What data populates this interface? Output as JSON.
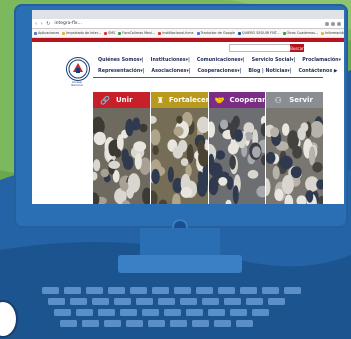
{
  "browser": {
    "nav_glyphs": "‹ › ↻",
    "url": "integra-flx...",
    "bookmarks": [
      "Aplicaciones",
      "Importado de Inter...",
      "SMS",
      "ForoColimas Mexi...",
      "InstiNacional.fcmx",
      "Traductor de Google",
      "QUIERO SEGUIR FNT...",
      "Otros Cuadernos...",
      "Información de dispo..."
    ]
  },
  "site": {
    "search_button": "Buscar",
    "logo_caption": "Consejo Nacional",
    "menu_row1": [
      "Quiénes Somos▾|",
      "Instituciones▾|",
      "Comunicaciones▾|",
      "Servicio Social▾|",
      "Proclamación▾"
    ],
    "menu_row2": [
      "Representación▾|",
      "Asociaciones▾|",
      "Cooperaciones▾|",
      "Blog | Noticias▾|",
      "Contáctenos ▶"
    ],
    "tiles": [
      {
        "label": "Unir",
        "icon": "link-icon",
        "glyph": "🔗",
        "color": "#c8202a"
      },
      {
        "label": "Fortalecer",
        "icon": "tower-icon",
        "glyph": "♜",
        "color": "#b89a1e"
      },
      {
        "label": "Cooperar",
        "icon": "handshake-icon",
        "glyph": "🤝",
        "color": "#7b2d86"
      },
      {
        "label": "Servir",
        "icon": "people-icon",
        "glyph": "⚇",
        "color": "#8a8d92"
      }
    ]
  }
}
